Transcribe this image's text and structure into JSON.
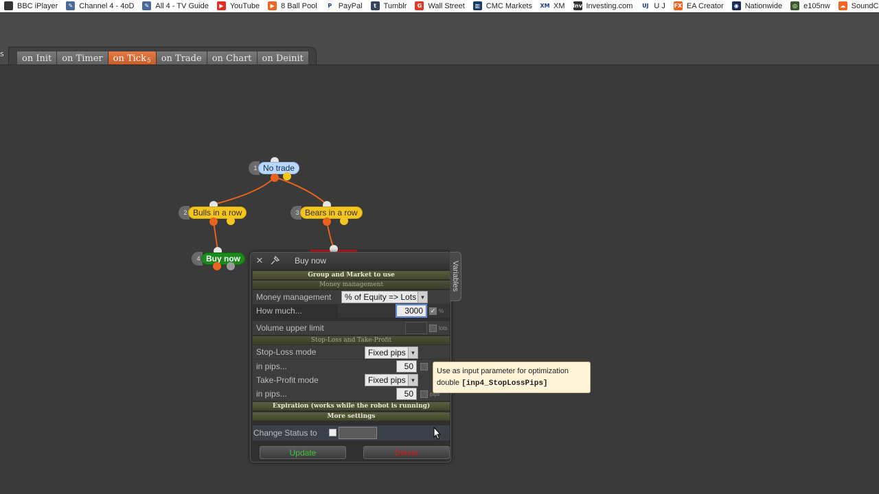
{
  "bookmarks": [
    {
      "label": "BBC iPlayer",
      "icon": "bbc-icon",
      "color": "#333333",
      "glyph": ""
    },
    {
      "label": "Channel 4 - 4oD",
      "icon": "channel4-icon",
      "color": "#4a6a9a",
      "glyph": "✎"
    },
    {
      "label": "All 4 - TV Guide",
      "icon": "all4-icon",
      "color": "#4a6a9a",
      "glyph": "✎"
    },
    {
      "label": "YouTube",
      "icon": "youtube-icon",
      "color": "#e52d27",
      "glyph": "▶"
    },
    {
      "label": "8 Ball Pool",
      "icon": "8ballpool-icon",
      "color": "#f26522",
      "glyph": "▶"
    },
    {
      "label": "PayPal",
      "icon": "paypal-icon",
      "color": "#ffffff",
      "glyph": "P"
    },
    {
      "label": "Tumblr",
      "icon": "tumblr-icon",
      "color": "#35465c",
      "glyph": "t"
    },
    {
      "label": "Wall Street",
      "icon": "wallstreet-icon",
      "color": "#e03a2a",
      "glyph": "G"
    },
    {
      "label": "CMC Markets",
      "icon": "cmc-icon",
      "color": "#1a3a6a",
      "glyph": "▥"
    },
    {
      "label": "XM",
      "icon": "xm-icon",
      "color": "#ffffff",
      "glyph": "XM"
    },
    {
      "label": "Investing.com",
      "icon": "investing-icon",
      "color": "#333333",
      "glyph": "Inv"
    },
    {
      "label": "U J",
      "icon": "uj-icon",
      "color": "#ffffff",
      "glyph": "UJ"
    },
    {
      "label": "EA Creator",
      "icon": "eacreator-icon",
      "color": "#f26522",
      "glyph": "FX"
    },
    {
      "label": "Nationwide",
      "icon": "nationwide-icon",
      "color": "#1a2a5a",
      "glyph": "◉"
    },
    {
      "label": "e105nw",
      "icon": "e105nw-icon",
      "color": "#3a5a2a",
      "glyph": "◎"
    },
    {
      "label": "SoundCloud",
      "icon": "soundcloud-icon",
      "color": "#f26522",
      "glyph": "☁"
    }
  ],
  "tabs": {
    "edge": "s",
    "items": [
      "on Init",
      "on Timer",
      "on Tick",
      "on Trade",
      "on Chart",
      "on Deinit"
    ],
    "active_badge": "5"
  },
  "nodes": {
    "n1": {
      "num": "1",
      "label": "No trade"
    },
    "n2": {
      "num": "2",
      "label": "Bulls in a row"
    },
    "n3": {
      "num": "3",
      "label": "Bears in a row"
    },
    "n4": {
      "num": "4",
      "label": "Buy now"
    }
  },
  "dialog": {
    "title": "Buy now",
    "variables_tab": "Variables",
    "sections": {
      "group": "Group and Market to use",
      "money": "Money management",
      "sltp": "Stop-Loss and Take-Profit",
      "expiration": "Expiration (works while the robot is running)",
      "more": "More settings"
    },
    "money_management_label": "Money management",
    "money_management_value": "% of Equity => Lots",
    "how_much_label": "How much...",
    "how_much_value": "3000",
    "how_much_unit": "%",
    "volume_label": "Volume upper limit",
    "volume_unit": "lots",
    "sl_mode_label": "Stop-Loss mode",
    "sl_mode_value": "Fixed pips",
    "sl_pips_label": "in pips...",
    "sl_pips_value": "50",
    "tp_mode_label": "Take-Profit mode",
    "tp_mode_value": "Fixed pips",
    "tp_pips_label": "in pips...",
    "tp_pips_value": "50",
    "tp_pips_unit": "pips",
    "change_status_label": "Change Status to",
    "update_label": "Update",
    "delete_label": "Delete",
    "colors": {
      "update": "#3cc43c",
      "delete": "#d01c1c"
    }
  },
  "tooltip": {
    "line1": "Use as input parameter for optimization",
    "type": "double",
    "param": "[inp4_StopLossPips]"
  }
}
